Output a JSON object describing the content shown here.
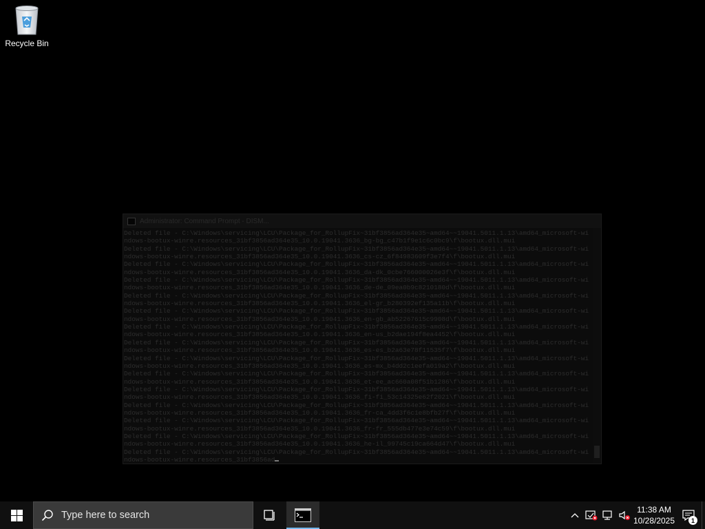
{
  "desktop": {
    "icons": [
      {
        "label": "Recycle Bin",
        "icon": "recycle-bin-icon"
      }
    ]
  },
  "console": {
    "title": "Administrator: Command Prompt - DISM...",
    "lines": [
      "Deleted file - C:\\Windows\\servicing\\LCU\\Package_for_RollupFix~31bf3856ad364e35~amd64~~19041.5011.1.13\\amd64_microsoft-wi",
      "ndows-bootux-winre.resources_31bf3856ad364e35_10.0.19041.3636_bg-bg_c47b1f9e1c6c0bc9\\f\\bootux.dll.mui",
      "Deleted file - C:\\Windows\\servicing\\LCU\\Package_for_RollupFix~31bf3856ad364e35~amd64~~19041.5011.1.13\\amd64_microsoft-wi",
      "ndows-bootux-winre.resources_31bf3856ad364e35_10.0.19041.3636_cs-cz_6f84983609f3e7f4\\f\\bootux.dll.mui",
      "Deleted file - C:\\Windows\\servicing\\LCU\\Package_for_RollupFix~31bf3856ad364e35~amd64~~19041.5011.1.13\\amd64_microsoft-wi",
      "ndows-bootux-winre.resources_31bf3856ad364e35_10.0.19041.3636_da-dk_0cbe766000026e3f\\f\\bootux.dll.mui",
      "Deleted file - C:\\Windows\\servicing\\LCU\\Package_for_RollupFix~31bf3856ad364e35~amd64~~19041.5011.1.13\\amd64_microsoft-wi",
      "ndows-bootux-winre.resources_31bf3856ad364e35_10.0.19041.3636_de-de_09ea0b9c8210180d\\f\\bootux.dll.mui",
      "Deleted file - C:\\Windows\\servicing\\LCU\\Package_for_RollupFix~31bf3856ad364e35~amd64~~19041.5011.1.13\\amd64_microsoft-wi",
      "ndows-bootux-winre.resources_31bf3856ad364e35_10.0.19041.3636_el-gr_b280392ef135a11b\\f\\bootux.dll.mui",
      "Deleted file - C:\\Windows\\servicing\\LCU\\Package_for_RollupFix~31bf3856ad364e35~amd64~~19041.5011.1.13\\amd64_microsoft-wi",
      "ndows-bootux-winre.resources_31bf3856ad364e35_10.0.19041.3636_en-gb_ab52267615c9908d\\f\\bootux.dll.mui",
      "Deleted file - C:\\Windows\\servicing\\LCU\\Package_for_RollupFix~31bf3856ad364e35~amd64~~19041.5011.1.13\\amd64_microsoft-wi",
      "ndows-bootux-winre.resources_31bf3856ad364e35_10.0.19041.3636_en-us_b2dae194f8ea4452\\f\\bootux.dll.mui",
      "Deleted file - C:\\Windows\\servicing\\LCU\\Package_for_RollupFix~31bf3856ad364e35~amd64~~19041.5011.1.13\\amd64_microsoft-wi",
      "ndows-bootux-winre.resources_31bf3856ad364e35_10.0.19041.3636_es-es_b2a63e78f11535f7\\f\\bootux.dll.mui",
      "Deleted file - C:\\Windows\\servicing\\LCU\\Package_for_RollupFix~31bf3856ad364e35~amd64~~19041.5011.1.13\\amd64_microsoft-wi",
      "ndows-bootux-winre.resources_31bf3856ad364e35_10.0.19041.3636_es-mx_b4dd2c1eefa019a2\\f\\bootux.dll.mui",
      "Deleted file - C:\\Windows\\servicing\\LCU\\Package_for_RollupFix~31bf3856ad364e35~amd64~~19041.5011.1.13\\amd64_microsoft-wi",
      "ndows-bootux-winre.resources_31bf3856ad364e35_10.0.19041.3636_et-ee_ac660a08f51b1286\\f\\bootux.dll.mui",
      "Deleted file - C:\\Windows\\servicing\\LCU\\Package_for_RollupFix~31bf3856ad364e35~amd64~~19041.5011.1.13\\amd64_microsoft-wi",
      "ndows-bootux-winre.resources_31bf3856ad364e35_10.0.19041.3636_fi-fi_53c14325e62f2021\\f\\bootux.dll.mui",
      "Deleted file - C:\\Windows\\servicing\\LCU\\Package_for_RollupFix~31bf3856ad364e35~amd64~~19041.5011.1.13\\amd64_microsoft-wi",
      "ndows-bootux-winre.resources_31bf3856ad364e35_10.0.19041.3636_fr-ca_4dd3f6c1e8bfb27f\\f\\bootux.dll.mui",
      "Deleted file - C:\\Windows\\servicing\\LCU\\Package_for_RollupFix~31bf3856ad364e35~amd64~~19041.5011.1.13\\amd64_microsoft-wi",
      "ndows-bootux-winre.resources_31bf3856ad364e35_10.0.19041.3636_fr-fr_555db477e3e74c59\\f\\bootux.dll.mui",
      "Deleted file - C:\\Windows\\servicing\\LCU\\Package_for_RollupFix~31bf3856ad364e35~amd64~~19041.5011.1.13\\amd64_microsoft-wi",
      "ndows-bootux-winre.resources_31bf3856ad364e35_10.0.19041.3636_he-il_99745c19ca664d47\\f\\bootux.dll.mui",
      "Deleted file - C:\\Windows\\servicing\\LCU\\Package_for_RollupFix~31bf3856ad364e35~amd64~~19041.5011.1.13\\amd64_microsoft-wi"
    ],
    "last_partial_line": "ndows-bootux-winre.resources_31bf3856ad"
  },
  "taskbar": {
    "start_icon": "windows-logo-icon",
    "search_placeholder": "Type here to search",
    "task_view_icon": "task-view-icon",
    "pinned_app_icon": "command-prompt-icon",
    "tray": {
      "icons": [
        "chevron-up-icon",
        "security-alert-icon",
        "network-disconnected-icon",
        "volume-muted-icon"
      ],
      "time": "11:38 AM",
      "date": "10/28/2025",
      "notification_count": "1"
    }
  }
}
